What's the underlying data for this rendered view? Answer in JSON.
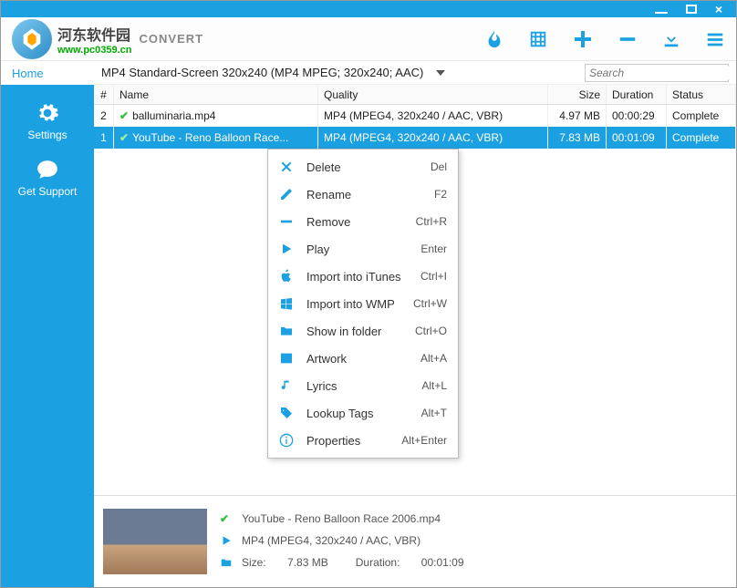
{
  "titlebar": {},
  "toolbar": {
    "watermark": "河东软件园",
    "url": "www.pc0359.cn",
    "convert": "CONVERT"
  },
  "sidebar": {
    "home": "Home",
    "settings": "Settings",
    "support": "Get Support"
  },
  "format": {
    "text": "MP4 Standard-Screen 320x240 (MP4 MPEG; 320x240; AAC)",
    "search_placeholder": "Search"
  },
  "columns": {
    "num": "#",
    "name": "Name",
    "quality": "Quality",
    "size": "Size",
    "duration": "Duration",
    "status": "Status"
  },
  "rows": [
    {
      "num": "2",
      "name": "balluminaria.mp4",
      "quality": "MP4  (MPEG4, 320x240 / AAC, VBR)",
      "size": "4.97 MB",
      "duration": "00:00:29",
      "status": "Complete"
    },
    {
      "num": "1",
      "name": "YouTube - Reno Balloon Race...",
      "quality": "MP4  (MPEG4, 320x240 / AAC, VBR)",
      "size": "7.83 MB",
      "duration": "00:01:09",
      "status": "Complete"
    }
  ],
  "menu": [
    {
      "icon": "delete",
      "label": "Delete",
      "short": "Del"
    },
    {
      "icon": "rename",
      "label": "Rename",
      "short": "F2"
    },
    {
      "icon": "remove",
      "label": "Remove",
      "short": "Ctrl+R"
    },
    {
      "icon": "play",
      "label": "Play",
      "short": "Enter"
    },
    {
      "icon": "itunes",
      "label": "Import into iTunes",
      "short": "Ctrl+I"
    },
    {
      "icon": "wmp",
      "label": "Import into WMP",
      "short": "Ctrl+W"
    },
    {
      "icon": "folder",
      "label": "Show in folder",
      "short": "Ctrl+O"
    },
    {
      "icon": "artwork",
      "label": "Artwork",
      "short": "Alt+A"
    },
    {
      "icon": "lyrics",
      "label": "Lyrics",
      "short": "Alt+L"
    },
    {
      "icon": "tags",
      "label": "Lookup Tags",
      "short": "Alt+T"
    },
    {
      "icon": "props",
      "label": "Properties",
      "short": "Alt+Enter"
    }
  ],
  "preview": {
    "filename": "YouTube - Reno Balloon Race 2006.mp4",
    "format": "MP4 (MPEG4, 320x240 / AAC, VBR)",
    "size_label": "Size:",
    "size": "7.83 MB",
    "dur_label": "Duration:",
    "duration": "00:01:09"
  }
}
